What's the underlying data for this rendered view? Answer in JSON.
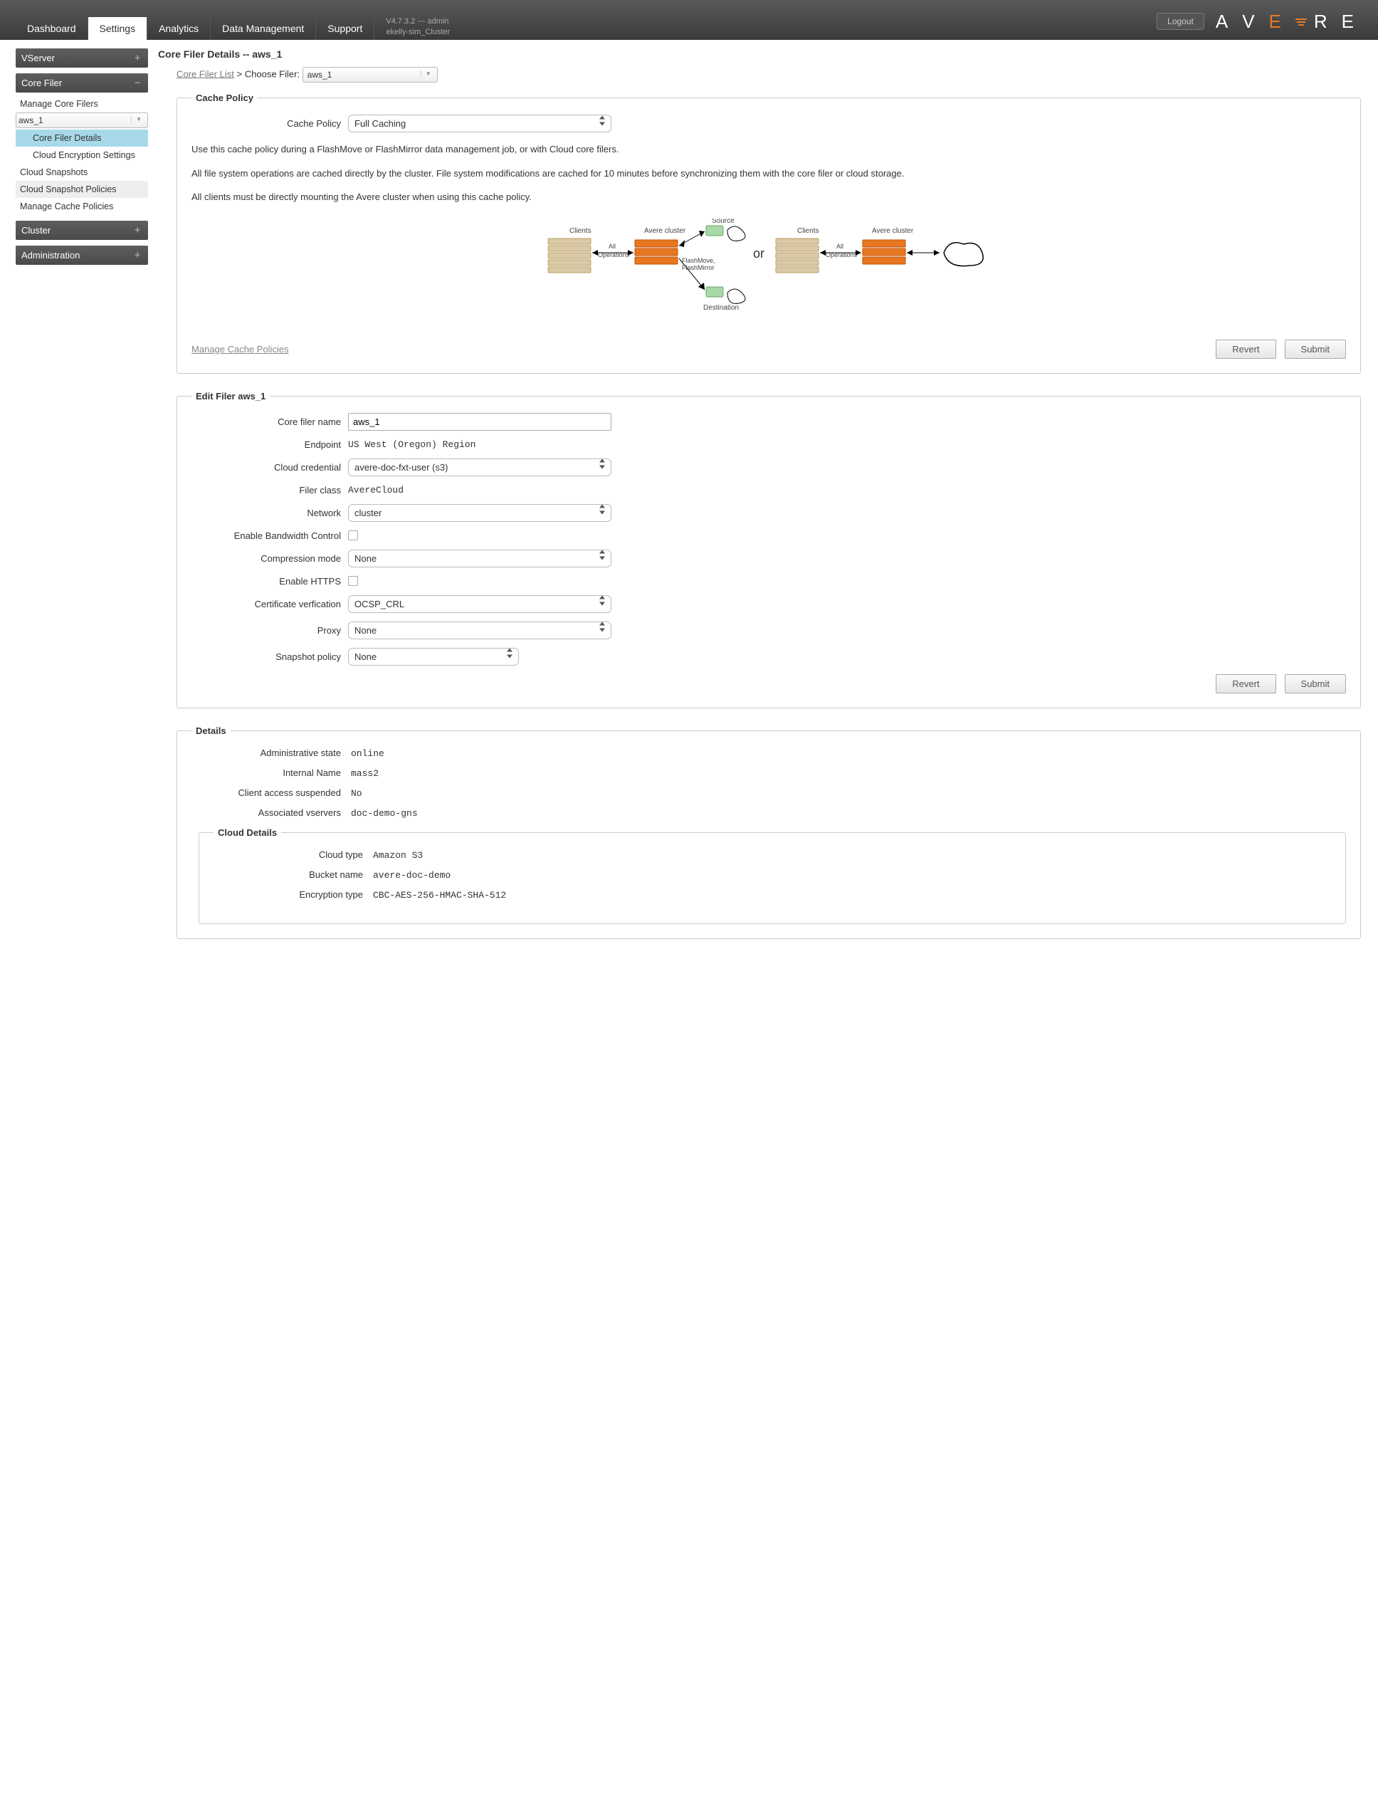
{
  "header": {
    "tabs": [
      "Dashboard",
      "Settings",
      "Analytics",
      "Data Management",
      "Support"
    ],
    "active_tab": "Settings",
    "version": "V4.7.3.2",
    "user": "admin",
    "cluster": "ekelly-sim_Cluster",
    "logout": "Logout",
    "logo": "AVERE"
  },
  "sidebar": {
    "vserver": {
      "label": "VServer",
      "icon": "plus"
    },
    "corefiler": {
      "label": "Core Filer",
      "icon": "minus",
      "items": {
        "manage": "Manage Core Filers",
        "selected_filer": "aws_1",
        "details": "Core Filer Details",
        "encryption": "Cloud Encryption Settings",
        "snapshots": "Cloud Snapshots",
        "snap_pol": "Cloud Snapshot Policies",
        "cache_pol": "Manage Cache Policies"
      }
    },
    "cluster": {
      "label": "Cluster",
      "icon": "plus"
    },
    "admin": {
      "label": "Administration",
      "icon": "plus"
    }
  },
  "page": {
    "title": "Core Filer Details -- aws_1",
    "crumb_link": "Core Filer List",
    "crumb_sep": " > Choose Filer: ",
    "crumb_value": "aws_1"
  },
  "cache_policy": {
    "legend": "Cache Policy",
    "label": "Cache Policy",
    "value": "Full Caching",
    "desc1": "Use this cache policy during a FlashMove or FlashMirror data management job, or with Cloud core filers.",
    "desc2": "All file system operations are cached directly by the cluster. File system modifications are cached for 10 minutes before synchronizing them with the core filer or cloud storage.",
    "desc3": "All clients must be directly mounting the Avere cluster when using this cache policy.",
    "manage_link": "Manage Cache Policies",
    "revert": "Revert",
    "submit": "Submit",
    "diagram": {
      "clients": "Clients",
      "avere": "Avere cluster",
      "allops": "All Operations",
      "source": "Source",
      "flashmove": "FlashMove, FlashMirror",
      "destination": "Destination",
      "or": "or"
    }
  },
  "edit_filer": {
    "legend": "Edit Filer aws_1",
    "rows": {
      "name_label": "Core filer name",
      "name_value": "aws_1",
      "endpoint_label": "Endpoint",
      "endpoint_value": "US West (Oregon) Region",
      "cred_label": "Cloud credential",
      "cred_value": "avere-doc-fxt-user (s3)",
      "class_label": "Filer class",
      "class_value": "AvereCloud",
      "network_label": "Network",
      "network_value": "cluster",
      "bw_label": "Enable Bandwidth Control",
      "comp_label": "Compression mode",
      "comp_value": "None",
      "https_label": "Enable HTTPS",
      "cert_label": "Certificate verfication",
      "cert_value": "OCSP_CRL",
      "proxy_label": "Proxy",
      "proxy_value": "None",
      "snap_label": "Snapshot policy",
      "snap_value": "None"
    },
    "revert": "Revert",
    "submit": "Submit"
  },
  "details": {
    "legend": "Details",
    "rows": {
      "adminstate_l": "Administrative state",
      "adminstate_v": "online",
      "internal_l": "Internal Name",
      "internal_v": "mass2",
      "suspended_l": "Client access suspended",
      "suspended_v": "No",
      "vservers_l": "Associated vservers",
      "vservers_v": "doc-demo-gns"
    },
    "cloud": {
      "legend": "Cloud Details",
      "type_l": "Cloud type",
      "type_v": "Amazon S3",
      "bucket_l": "Bucket name",
      "bucket_v": "avere-doc-demo",
      "enc_l": "Encryption type",
      "enc_v": "CBC-AES-256-HMAC-SHA-512"
    }
  }
}
